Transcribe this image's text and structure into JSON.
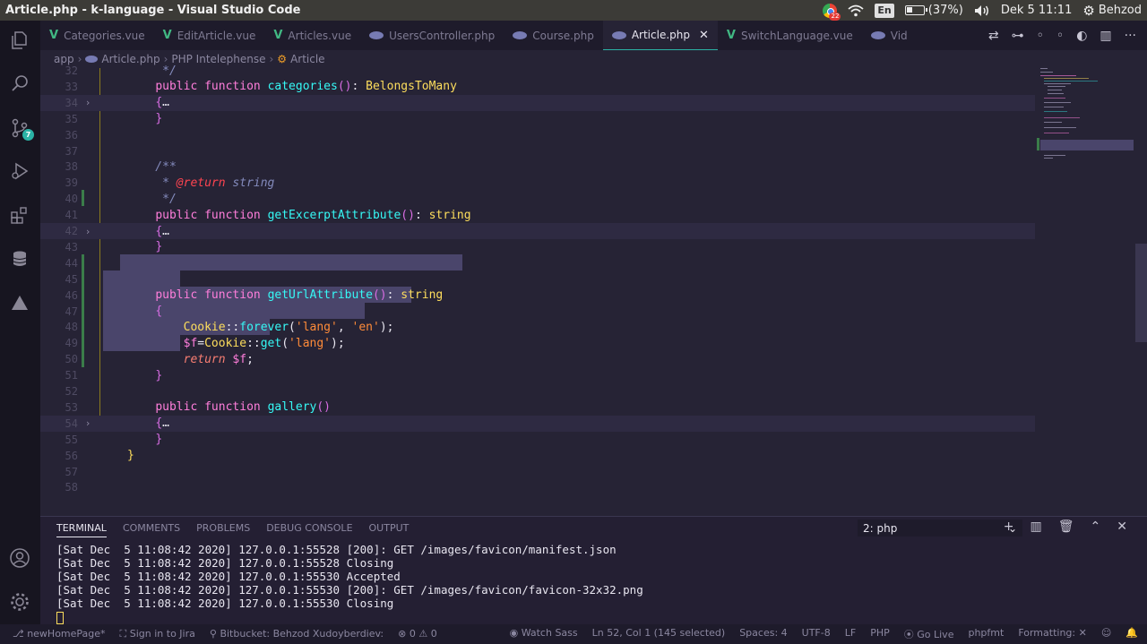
{
  "window": {
    "title": "Article.php - k-language - Visual Studio Code"
  },
  "system_tray": {
    "battery": "(37%)",
    "clock": "Dek  5 11:11",
    "user": "Behzod",
    "lang": "En",
    "chrome_badge": "22",
    "battery_level": 0.37
  },
  "activity": {
    "scm_badge": "7"
  },
  "tabs": [
    {
      "label": "Categories.vue",
      "kind": "vue"
    },
    {
      "label": "EditArticle.vue",
      "kind": "vue"
    },
    {
      "label": "Articles.vue",
      "kind": "vue"
    },
    {
      "label": "UsersController.php",
      "kind": "php"
    },
    {
      "label": "Course.php",
      "kind": "php"
    },
    {
      "label": "Article.php",
      "kind": "php",
      "active": true
    },
    {
      "label": "SwitchLanguage.vue",
      "kind": "vue"
    },
    {
      "label": "Vid",
      "kind": "php"
    }
  ],
  "breadcrumb": {
    "b0": "app",
    "b1": "Article.php",
    "b2": "PHP Intelephense",
    "b3": "Article"
  },
  "editor": {
    "lines": [
      {
        "n": "32",
        "html": "<span class='cmt'>     */</span>"
      },
      {
        "n": "33",
        "html": "    <span class='pink'>public</span> <span class='pink'>function</span> <span class='fn'>categories</span><span class='brace'>()</span>: <span class='ty'>BelongsToMany</span>"
      },
      {
        "n": "34",
        "fold": true,
        "bg": true,
        "html": "    <span class='brace'>{</span>…"
      },
      {
        "n": "35",
        "html": "    <span class='brace'>}</span>"
      },
      {
        "n": "36",
        "html": ""
      },
      {
        "n": "37",
        "html": ""
      },
      {
        "n": "38",
        "html": "<span class='cmt'>    /**</span>"
      },
      {
        "n": "39",
        "html": "<span class='cmt'>     * </span><span class='tag'>@return</span><span class='cmt'> string</span>"
      },
      {
        "n": "40",
        "html": "<span class='cmt'>     */</span>"
      },
      {
        "n": "41",
        "html": "    <span class='pink'>public</span> <span class='pink'>function</span> <span class='fn'>getExcerptAttribute</span><span class='brace'>()</span>: <span class='ty'>string</span>"
      },
      {
        "n": "42",
        "fold": true,
        "bg": true,
        "html": "    <span class='brace'>{</span>…"
      },
      {
        "n": "43",
        "html": "    <span class='brace'>}</span>"
      },
      {
        "n": "44",
        "html": ""
      },
      {
        "n": "45",
        "html": ""
      },
      {
        "n": "46",
        "html": "    <span class='pink'>public</span> <span class='pink'>function</span> <span class='fn'>getUrlAttribute</span><span class='brace'>()</span>: <span class='ty'>string</span>"
      },
      {
        "n": "47",
        "html": "    <span class='brace'>{</span>"
      },
      {
        "n": "48",
        "html": "        <span class='cls'>Cookie</span>::<span class='fn'>forever</span>(<span class='str'>'lang'</span>, <span class='str'>'en'</span>);"
      },
      {
        "n": "49",
        "html": "        <span class='pink'>$f</span>=<span class='cls'>Cookie</span>::<span class='fn'>get</span>(<span class='str'>'lang'</span>);"
      },
      {
        "n": "50",
        "html": "        <span class='kw2' style='font-style:italic'>return</span> <span class='pink'>$f</span>;"
      },
      {
        "n": "51",
        "html": "    <span class='brace'>}</span>"
      },
      {
        "n": "52",
        "html": ""
      },
      {
        "n": "53",
        "html": "    <span class='pink'>public</span> <span class='pink'>function</span> <span class='fn'>gallery</span><span class='brace'>()</span>"
      },
      {
        "n": "54",
        "fold": true,
        "bg": true,
        "html": "    <span class='brace'>{</span>…"
      },
      {
        "n": "55",
        "html": "    <span class='brace'>}</span>"
      },
      {
        "n": "56",
        "html": "<span class='kw'>}</span>"
      },
      {
        "n": "57",
        "html": ""
      },
      {
        "n": "58",
        "html": ""
      }
    ]
  },
  "panel": {
    "tabs": [
      "TERMINAL",
      "COMMENTS",
      "PROBLEMS",
      "DEBUG CONSOLE",
      "OUTPUT"
    ],
    "terminal_select": "2: php",
    "lines": [
      "[Sat Dec  5 11:08:42 2020] 127.0.0.1:55528 [200]: GET /images/favicon/manifest.json",
      "[Sat Dec  5 11:08:42 2020] 127.0.0.1:55528 Closing",
      "[Sat Dec  5 11:08:42 2020] 127.0.0.1:55530 Accepted",
      "[Sat Dec  5 11:08:42 2020] 127.0.0.1:55530 [200]: GET /images/favicon/favicon-32x32.png",
      "[Sat Dec  5 11:08:42 2020] 127.0.0.1:55530 Closing"
    ]
  },
  "status": {
    "branch": "newHomePage*",
    "jira": "Sign in to Jira",
    "bitbucket": "Bitbucket: Behzod Xudoyberdiev:",
    "problems": "⊗ 0 ⚠ 0",
    "watch_sass": "Watch Sass",
    "position": "Ln 52, Col 1 (145 selected)",
    "spaces": "Spaces: 4",
    "encoding": "UTF-8",
    "eol": "LF",
    "language": "PHP",
    "golive": "Go Live",
    "phpfmt": "phpfmt",
    "formatting": "Formatting: ✕"
  }
}
